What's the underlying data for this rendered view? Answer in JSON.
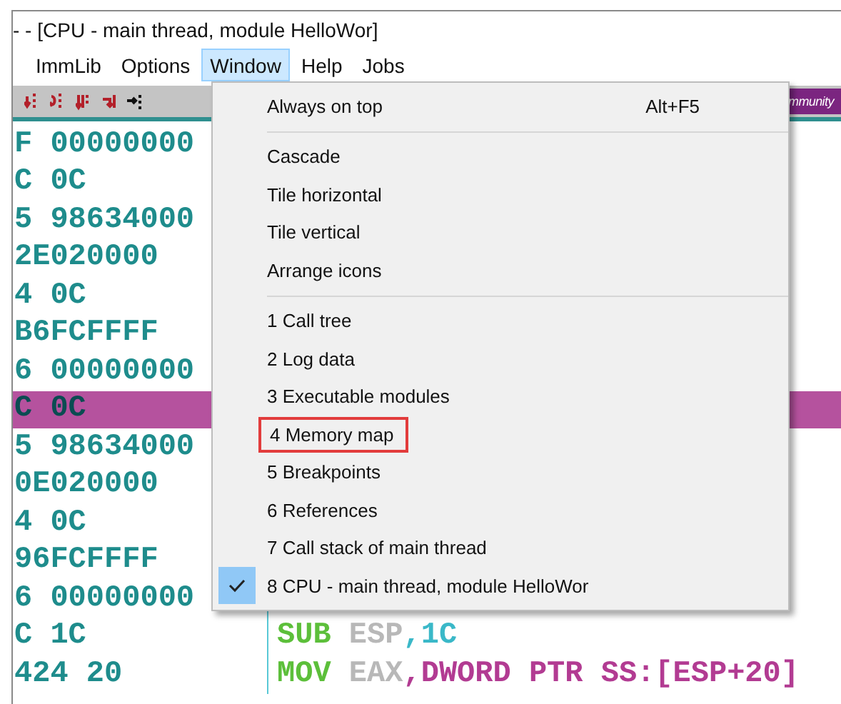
{
  "window": {
    "title": "- - [CPU - main thread, module HelloWor]"
  },
  "menu_bar": [
    {
      "label": "ImmLib",
      "selected": false
    },
    {
      "label": "Options",
      "selected": false
    },
    {
      "label": "Window",
      "selected": true
    },
    {
      "label": "Help",
      "selected": false
    },
    {
      "label": "Jobs",
      "selected": false
    }
  ],
  "toolbar": {
    "badge": "mmunity"
  },
  "rows": [
    {
      "dump": "F 00000000",
      "selected": false
    },
    {
      "dump": "C 0C",
      "selected": false
    },
    {
      "dump": "5 98634000",
      "selected": false
    },
    {
      "dump": "2E020000",
      "selected": false
    },
    {
      "dump": "4 0C",
      "selected": false
    },
    {
      "dump": "B6FCFFFF",
      "selected": false
    },
    {
      "dump": "6 00000000",
      "selected": false
    },
    {
      "dump": "C 0C",
      "selected": true
    },
    {
      "dump": "5 98634000",
      "selected": false
    },
    {
      "dump": "0E020000",
      "selected": false
    },
    {
      "dump": "4 0C",
      "selected": false
    },
    {
      "dump": "96FCFFFF",
      "selected": false
    },
    {
      "dump": "6 00000000",
      "selected": false
    },
    {
      "dump": "C 1C",
      "selected": false,
      "code": [
        {
          "kind": "mnemonic",
          "text": "SUB"
        },
        {
          "kind": "register",
          "text": "ESP"
        },
        {
          "kind": "immediate",
          "text": ",1C"
        }
      ]
    },
    {
      "dump": "424 20",
      "selected": false,
      "code": [
        {
          "kind": "mnemonic",
          "text": "MOV"
        },
        {
          "kind": "register",
          "text": "EAX"
        },
        {
          "kind": "memory",
          "text": ",DWORD PTR SS:[ESP+20]"
        }
      ]
    }
  ],
  "window_menu": {
    "items": [
      {
        "kind": "item",
        "label": "Always on top",
        "shortcut": "Alt+F5",
        "checked": false,
        "annotated": false
      },
      {
        "kind": "separator"
      },
      {
        "kind": "item",
        "label": "Cascade",
        "checked": false,
        "annotated": false
      },
      {
        "kind": "item",
        "label": "Tile horizontal",
        "checked": false,
        "annotated": false
      },
      {
        "kind": "item",
        "label": "Tile vertical",
        "checked": false,
        "annotated": false
      },
      {
        "kind": "item",
        "label": "Arrange icons",
        "checked": false,
        "annotated": false
      },
      {
        "kind": "separator"
      },
      {
        "kind": "item",
        "label": "1 Call tree",
        "checked": false,
        "annotated": false
      },
      {
        "kind": "item",
        "label": "2 Log data",
        "checked": false,
        "annotated": false
      },
      {
        "kind": "item",
        "label": "3 Executable modules",
        "checked": false,
        "annotated": false
      },
      {
        "kind": "item",
        "label": "4 Memory map",
        "checked": false,
        "annotated": true
      },
      {
        "kind": "item",
        "label": "5 Breakpoints",
        "checked": false,
        "annotated": false
      },
      {
        "kind": "item",
        "label": "6 References",
        "checked": false,
        "annotated": false
      },
      {
        "kind": "item",
        "label": "7 Call stack of main thread",
        "checked": false,
        "annotated": false
      },
      {
        "kind": "item",
        "label": "8 CPU - main thread, module HelloWor",
        "checked": true,
        "annotated": false
      }
    ]
  }
}
